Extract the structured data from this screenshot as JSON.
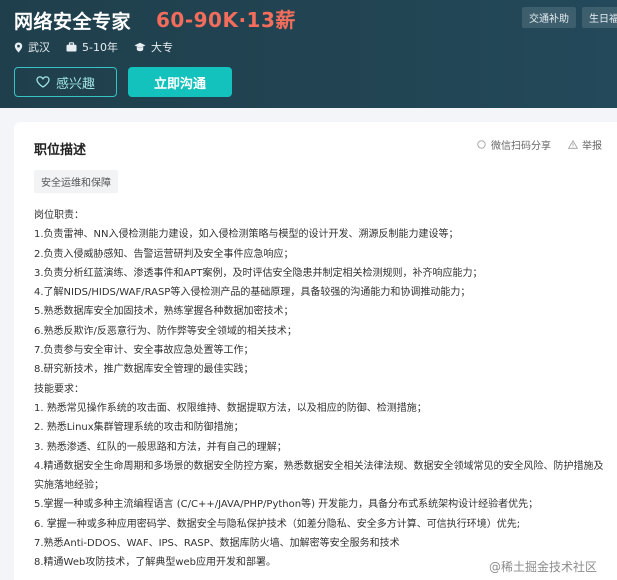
{
  "header": {
    "title": "网络安全专家",
    "salary": "60-90K·13薪",
    "benefits": [
      "交通补助",
      "生日福"
    ],
    "meta": {
      "city": "武汉",
      "experience": "5-10年",
      "education": "大专"
    },
    "buttons": {
      "interest": "感兴趣",
      "chat": "立即沟通"
    }
  },
  "card": {
    "section_title": "职位描述",
    "share_label": "微信扫码分享",
    "report_label": "举报",
    "tag": "安全运维和保障",
    "lines": [
      "岗位职责：",
      "1.负责雷神、NN入侵检测能力建设，如入侵检测策略与模型的设计开发、溯源反制能力建设等；",
      "2.负责入侵威胁感知、告警运营研判及安全事件应急响应；",
      "3.负责分析红蓝演练、渗透事件和APT案例，及时评估安全隐患并制定相关检测规则，补齐响应能力；",
      "4.了解NIDS/HIDS/WAF/RASP等入侵检测产品的基础原理，具备较强的沟通能力和协调推动能力；",
      "5.熟悉数据库安全加固技术，熟练掌握各种数据加密技术；",
      "6.熟悉反欺诈/反恶意行为、防作弊等安全领域的相关技术；",
      "7.负责参与安全审计、安全事故应急处置等工作；",
      "8.研究新技术，推广数据库安全管理的最佳实践；",
      "技能要求：",
      "1. 熟悉常见操作系统的攻击面、权限维持、数据提取方法，以及相应的防御、检测措施；",
      "2. 熟悉Linux集群管理系统的攻击和防御措施；",
      "3. 熟悉渗透、红队的一般思路和方法，并有自己的理解；",
      "4.精通数据安全生命周期和多场景的数据安全防控方案，熟悉数据安全相关法律法规、数据安全领域常见的安全风险、防护措施及实施落地经验；",
      "5.掌握一种或多种主流编程语言 (C/C++/JAVA/PHP/Python等) 开发能力，具备分布式系统架构设计经验者优先；",
      "6. 掌握一种或多种应用密码学、数据安全与隐私保护技术（如差分隐私、安全多方计算、可信执行环境）优先;",
      "7.熟悉Anti-DDOS、WAF、IPS、RASP、数据库防火墙、加解密等安全服务和技术",
      "8.精通Web攻防技术，了解典型web应用开发和部署。"
    ]
  },
  "watermark": "@稀土掘金技术社区"
}
